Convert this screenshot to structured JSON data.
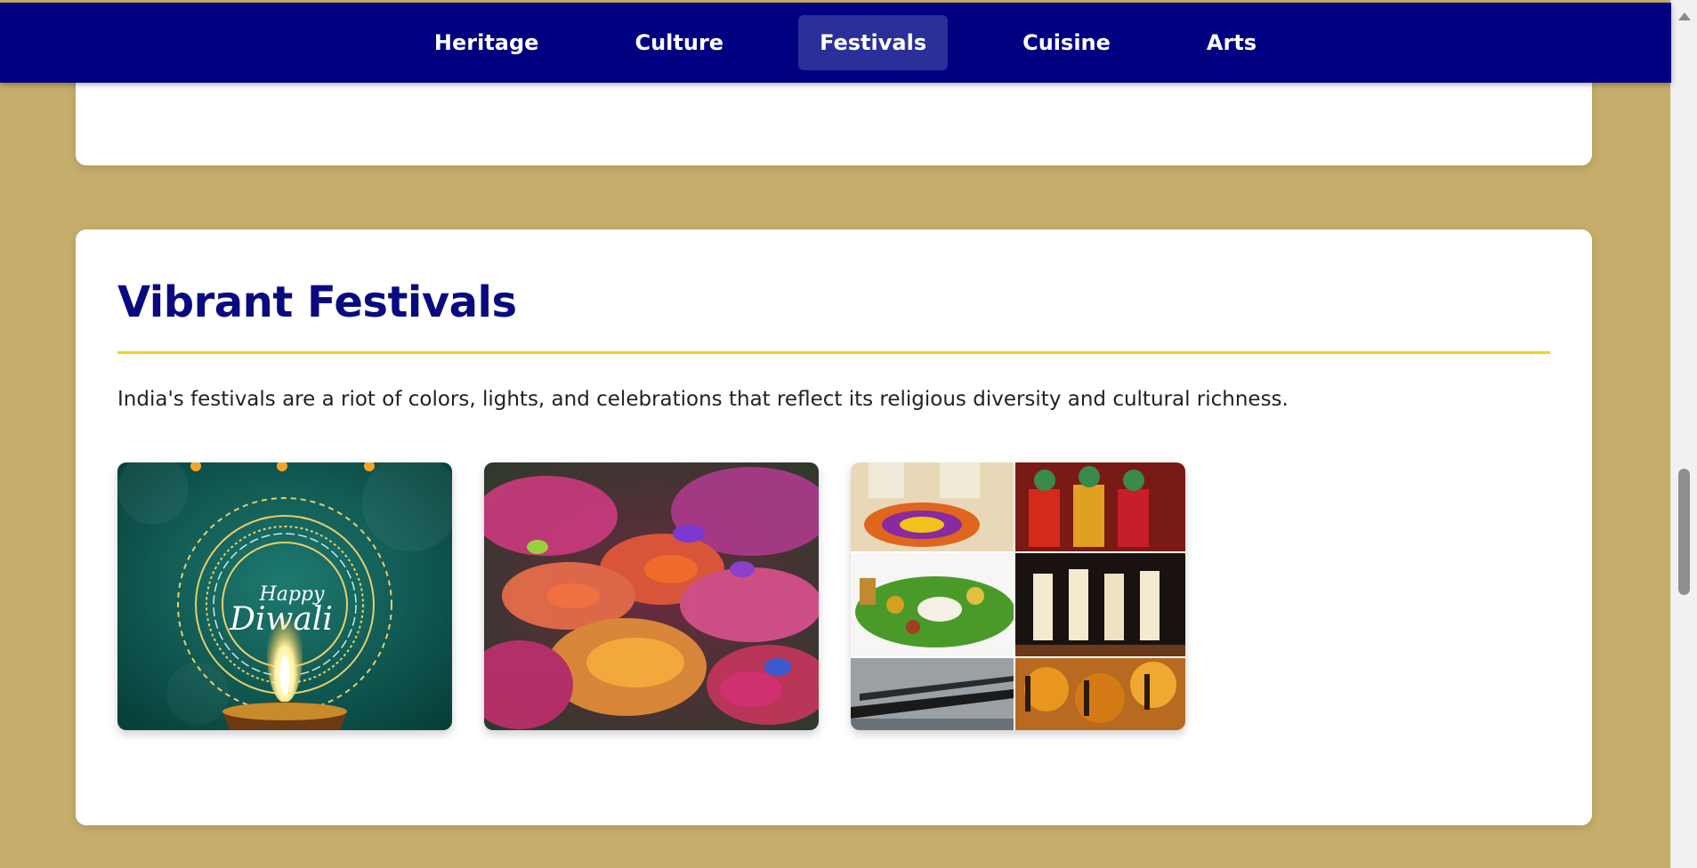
{
  "nav": {
    "items": [
      {
        "label": "Heritage",
        "active": false
      },
      {
        "label": "Culture",
        "active": false
      },
      {
        "label": "Festivals",
        "active": true
      },
      {
        "label": "Cuisine",
        "active": false
      },
      {
        "label": "Arts",
        "active": false
      }
    ]
  },
  "section": {
    "title": "Vibrant Festivals",
    "intro": "India's festivals are a riot of colors, lights, and celebrations that reflect its religious diversity and cultural richness."
  },
  "gallery": {
    "diwali": {
      "line1": "Happy",
      "line2": "Diwali"
    }
  },
  "colors": {
    "nav_bg": "#000080",
    "accent": "#f2d31b",
    "title": "#0a0a80",
    "page_bg": "#c5ae6b"
  }
}
